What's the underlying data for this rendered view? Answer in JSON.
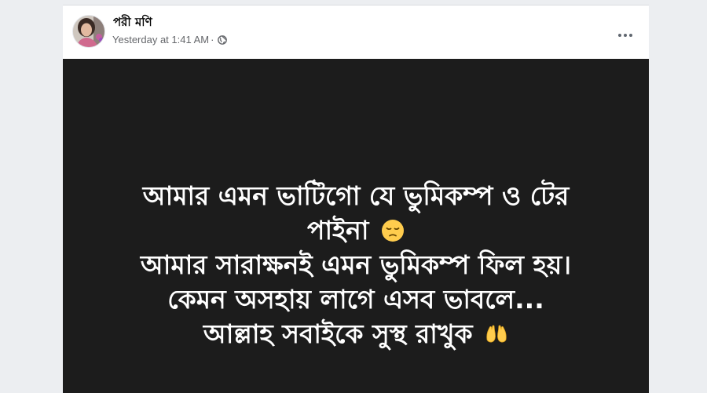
{
  "post": {
    "author_name": "পরী মণি",
    "timestamp": "Yesterday at 1:41 AM",
    "separator": "·",
    "privacy_icon": "globe-icon",
    "more_icon": "more-options-icon",
    "background_color": "#1c1c1c",
    "text_color": "#ffffff",
    "lines": {
      "line1": "আমার এমন ভাটিগো যে ভুমিকম্প ও টের",
      "line2": "পাইনা",
      "line2_emoji": "pensive-face-emoji",
      "line3": "আমার সারাক্ষনই এমন ভুমিকম্প ফিল হয়।",
      "line4": "কেমন অসহায় লাগে এসব ভাবলে...",
      "line5": "আল্লাহ সবাইকে সুস্থ রাখুক",
      "line5_emoji": "raising-hands-emoji"
    }
  }
}
